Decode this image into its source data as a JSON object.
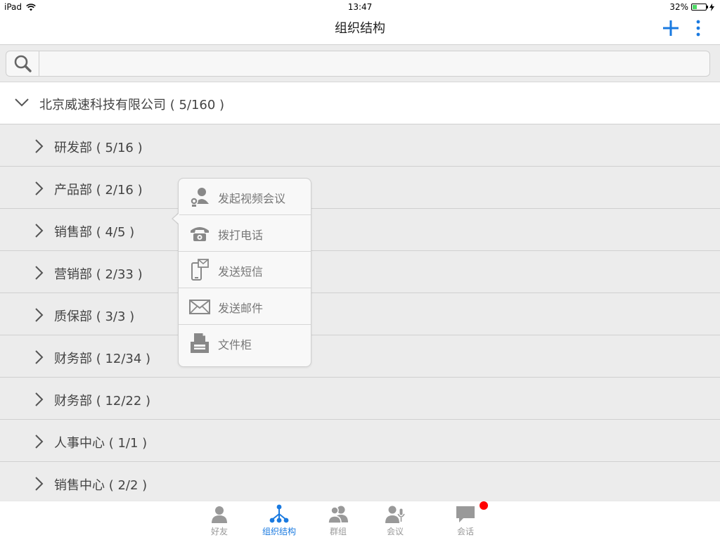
{
  "status_bar": {
    "device": "iPad",
    "time": "13:47",
    "battery": "32%",
    "battery_level": 0.32
  },
  "nav": {
    "title": "组织结构",
    "add_icon": "plus-icon",
    "more_icon": "more-vertical-icon"
  },
  "search": {
    "placeholder": "",
    "value": ""
  },
  "company": {
    "label": "北京威速科技有限公司 ( 5/160 )",
    "expanded": true
  },
  "departments": [
    {
      "label": "研发部 ( 5/16 )"
    },
    {
      "label": "产品部 ( 2/16 )"
    },
    {
      "label": "销售部 ( 4/5 )"
    },
    {
      "label": "营销部 ( 2/33 )"
    },
    {
      "label": "质保部 ( 3/3 )"
    },
    {
      "label": "财务部 ( 12/34 )"
    },
    {
      "label": "财务部 ( 12/22 )"
    },
    {
      "label": "人事中心 ( 1/1 )"
    },
    {
      "label": "销售中心 ( 2/2 )"
    }
  ],
  "popover": {
    "items": [
      {
        "label": "发起视频会议",
        "icon": "video-conference-icon"
      },
      {
        "label": "拨打电话",
        "icon": "phone-icon"
      },
      {
        "label": "发送短信",
        "icon": "sms-icon"
      },
      {
        "label": "发送邮件",
        "icon": "mail-icon"
      },
      {
        "label": "文件柜",
        "icon": "file-cabinet-icon"
      }
    ]
  },
  "tabs": [
    {
      "label": "好友",
      "icon": "friends-icon",
      "active": false
    },
    {
      "label": "组织结构",
      "icon": "org-structure-icon",
      "active": true
    },
    {
      "label": "群组",
      "icon": "groups-icon",
      "active": false
    },
    {
      "label": "会议",
      "icon": "meeting-icon",
      "active": false
    },
    {
      "label": "会话",
      "icon": "chat-icon",
      "active": false
    }
  ],
  "colors": {
    "accent": "#1a7ae0",
    "badge": "#ff0000",
    "list_bg": "#ececec",
    "inactive": "#999999"
  }
}
